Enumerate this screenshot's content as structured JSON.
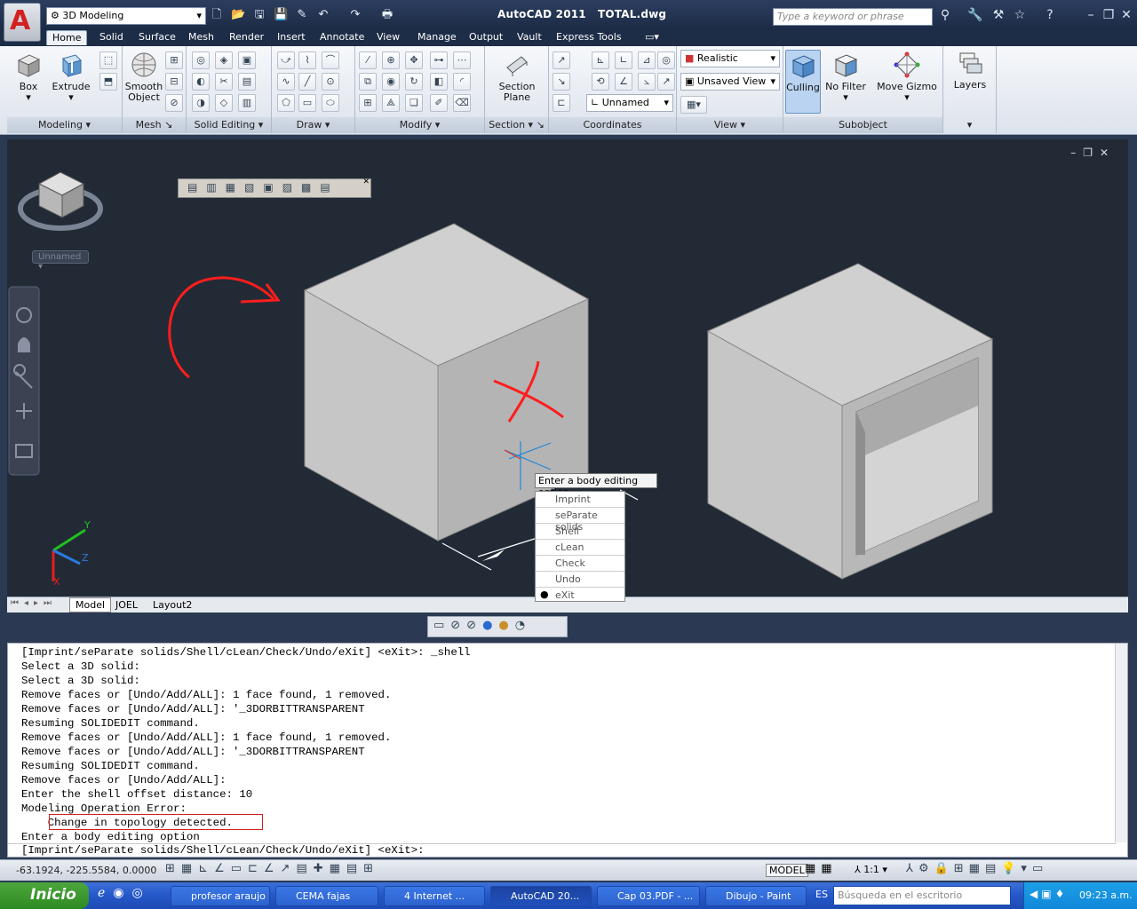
{
  "app": {
    "title": "AutoCAD 2011",
    "file": "TOTAL.dwg",
    "workspace": "3D Modeling",
    "search_placeholder": "Type a keyword or phrase"
  },
  "tabs": [
    "Home",
    "Solid",
    "Surface",
    "Mesh",
    "Render",
    "Insert",
    "Annotate",
    "View",
    "Manage",
    "Output",
    "Vault",
    "Express Tools"
  ],
  "panels": {
    "modeling": {
      "title": "Modeling",
      "box": "Box",
      "extrude": "Extrude"
    },
    "mesh": {
      "title": "Mesh",
      "smooth1": "Smooth",
      "smooth2": "Object"
    },
    "solid_editing": {
      "title": "Solid Editing"
    },
    "draw": {
      "title": "Draw"
    },
    "modify": {
      "title": "Modify"
    },
    "section": {
      "title": "Section",
      "btn1": "Section",
      "btn2": "Plane"
    },
    "coordinates": {
      "title": "Coordinates",
      "ucs": "Unnamed"
    },
    "view": {
      "title": "View",
      "visual_style": "Realistic",
      "named_view": "Unsaved View"
    },
    "subobject": {
      "title": "Subobject",
      "culling": "Culling",
      "filter": "No Filter",
      "gizmo": "Move Gizmo"
    },
    "layers": {
      "title": "Layers"
    }
  },
  "viewport": {
    "viewcube_label": "Unnamed",
    "tooltip": "Enter a body editing option",
    "ucs_y": "Y",
    "ucs_z": "Z",
    "ucs_x": "X",
    "layout_tabs": [
      "Model",
      "JOEL",
      "Layout2"
    ]
  },
  "context_menu": [
    "Imprint",
    "seParate solids",
    "Shell",
    "cLean",
    "Check",
    "Undo",
    "eXit"
  ],
  "command_history": [
    "[Imprint/seParate solids/Shell/cLean/Check/Undo/eXit] <eXit>: _shell",
    "Select a 3D solid:",
    "Select a 3D solid:",
    "Remove faces or [Undo/Add/ALL]: 1 face found, 1 removed.",
    "Remove faces or [Undo/Add/ALL]: '_3DORBITTRANSPARENT",
    "Resuming SOLIDEDIT command.",
    "Remove faces or [Undo/Add/ALL]: 1 face found, 1 removed.",
    "Remove faces or [Undo/Add/ALL]: '_3DORBITTRANSPARENT",
    "Resuming SOLIDEDIT command.",
    "Remove faces or [Undo/Add/ALL]:",
    "Enter the shell offset distance: 10",
    "Modeling Operation Error:",
    "    Change in topology detected.",
    "Enter a body editing option"
  ],
  "command_prompt": "[Imprint/seParate solids/Shell/cLean/Check/Undo/eXit] <eXit>:",
  "status": {
    "coords": "-63.1924, -225.5584, 0.0000",
    "model": "MODEL",
    "scale": "1:1"
  },
  "taskbar": {
    "start": "Inicio",
    "items": [
      "profesor araujo",
      "CEMA fajas",
      "4 Internet ...",
      "AutoCAD 20...",
      "Cap 03.PDF - ...",
      "Dibujo - Paint"
    ],
    "lang": "ES",
    "desktop_search": "Búsqueda en el escritorio",
    "clock": "09:23 a.m."
  }
}
